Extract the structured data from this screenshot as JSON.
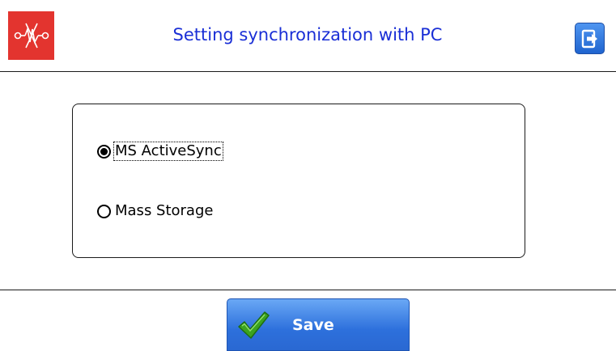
{
  "header": {
    "title": "Setting synchronization with PC",
    "logo_icon": "resistor-logo-icon",
    "exit_icon": "exit-door-icon"
  },
  "sync_options": {
    "items": [
      {
        "label": "MS ActiveSync",
        "selected": true
      },
      {
        "label": "Mass Storage",
        "selected": false
      }
    ]
  },
  "footer": {
    "save_label": "Save",
    "save_icon": "checkmark-icon"
  },
  "colors": {
    "title_blue": "#1a2fd6",
    "logo_red": "#e3342f",
    "button_blue": "#2d70dc",
    "check_green": "#3ca31f"
  }
}
